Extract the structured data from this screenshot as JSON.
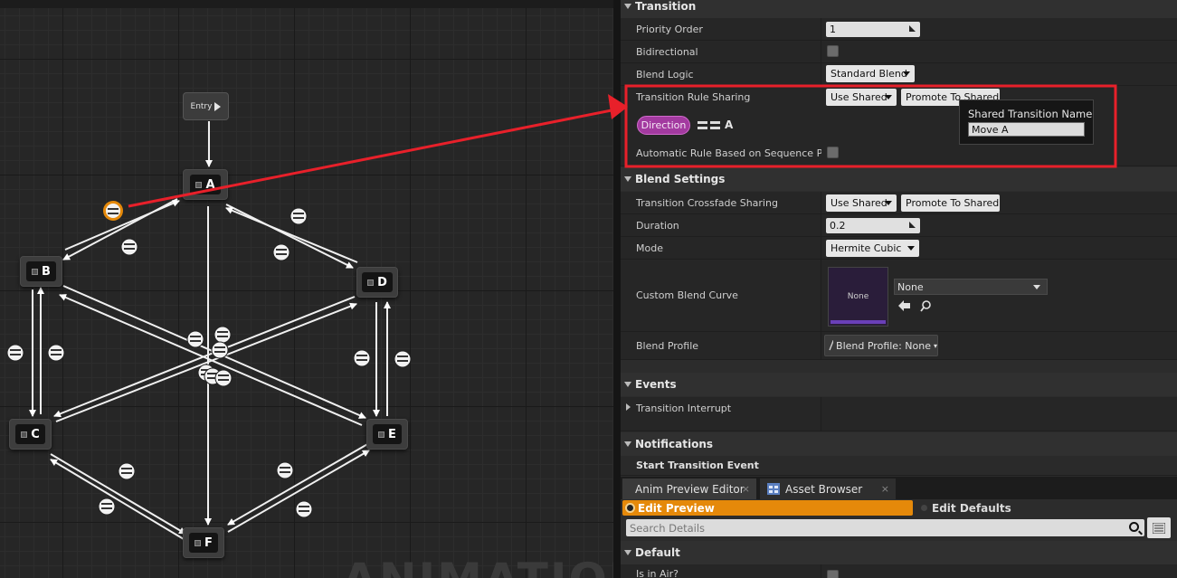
{
  "graph": {
    "entry_label": "Entry",
    "watermark": "ANIMATION",
    "states": [
      "A",
      "B",
      "C",
      "D",
      "E",
      "F"
    ]
  },
  "details": {
    "transition": {
      "title": "Transition",
      "priority_order_label": "Priority Order",
      "priority_order_value": "1",
      "bidirectional_label": "Bidirectional",
      "blend_logic_label": "Blend Logic",
      "blend_logic_value": "Standard Blend",
      "rule_sharing_label": "Transition Rule Sharing",
      "rule_sharing_value": "Use Shared",
      "promote_label": "Promote To Shared",
      "direction_label": "Direction",
      "compare_value": "A",
      "auto_rule_label": "Automatic Rule Based on Sequence Player in State"
    },
    "tooltip": {
      "title": "Shared Transition Name",
      "value": "Move A"
    },
    "blend_settings": {
      "title": "Blend Settings",
      "crossfade_sharing_label": "Transition Crossfade Sharing",
      "crossfade_sharing_value": "Use Shared",
      "promote_label": "Promote To Shared",
      "duration_label": "Duration",
      "duration_value": "0.2",
      "mode_label": "Mode",
      "mode_value": "Hermite Cubic",
      "custom_curve_label": "Custom Blend Curve",
      "curve_thumb_label": "None",
      "curve_asset_value": "None",
      "blend_profile_label": "Blend Profile",
      "blend_profile_value": "Blend Profile: None"
    },
    "events": {
      "title": "Events",
      "transition_interrupt_label": "Transition Interrupt"
    },
    "notifications": {
      "title": "Notifications",
      "start_transition_event": "Start Transition Event"
    },
    "tabs": [
      {
        "label": "Anim Preview Editor"
      },
      {
        "label": "Asset Browser"
      }
    ],
    "edit_preview_label": "Edit Preview",
    "edit_defaults_label": "Edit Defaults",
    "search_placeholder": "Search Details",
    "default_category": "Default",
    "is_in_air_label": "Is in Air?"
  },
  "colors": {
    "accent_orange": "#e5890a",
    "highlight_red": "#e8202a",
    "direction_pill": "#a33aa0"
  }
}
